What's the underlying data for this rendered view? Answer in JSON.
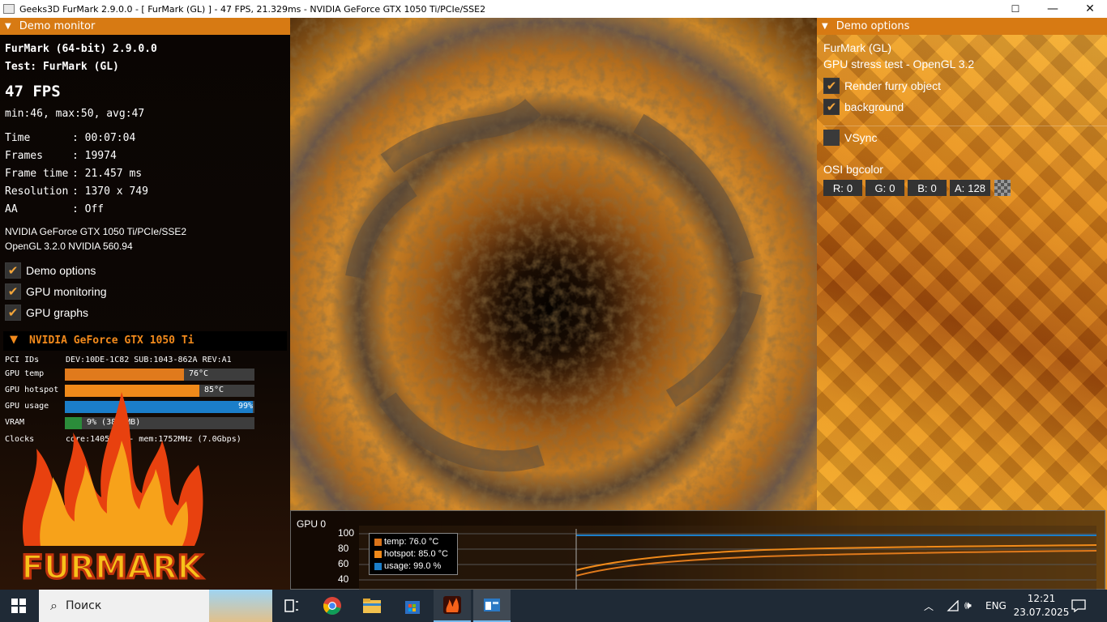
{
  "window": {
    "title": "Geeks3D FurMark 2.9.0.0 - [ FurMark (GL) ] - 47 FPS, 21.329ms - NVIDIA GeForce GTX 1050 Ti/PCIe/SSE2",
    "minimize_glyph": "—",
    "maximize_glyph": "☐",
    "close_glyph": "✕"
  },
  "monitor": {
    "header": "Demo monitor",
    "app_name": "FurMark (64-bit) 2.9.0.0",
    "test": "Test: FurMark (GL)",
    "fps": "47 FPS",
    "fps_stats": "min:46, max:50, avg:47",
    "stats": [
      {
        "label": "Time",
        "value": ": 00:07:04"
      },
      {
        "label": "Frames",
        "value": ": 19974"
      },
      {
        "label": "Frame time",
        "value": ": 21.457 ms"
      },
      {
        "label": "Resolution",
        "value": ": 1370 x 749"
      },
      {
        "label": "AA",
        "value": ": Off"
      }
    ],
    "renderer": "NVIDIA GeForce GTX 1050 Ti/PCIe/SSE2",
    "opengl": "OpenGL 3.2.0 NVIDIA 560.94",
    "toggles": [
      {
        "label": "Demo options",
        "checked": true
      },
      {
        "label": "GPU monitoring",
        "checked": true
      },
      {
        "label": "GPU graphs",
        "checked": true
      }
    ]
  },
  "gpu": {
    "name": "NVIDIA GeForce GTX 1050 Ti",
    "pci_label": "PCI IDs",
    "pci_value": "DEV:10DE-1C82 SUB:1043-862A REV:A1",
    "rows": [
      {
        "label": "GPU temp",
        "value": "76°C",
        "fill": 0.63,
        "color": "#e07a1c"
      },
      {
        "label": "GPU hotspot",
        "value": "85°C",
        "fill": 0.71,
        "color": "#f08a1a"
      },
      {
        "label": "GPU usage",
        "value": "99%",
        "fill": 0.99,
        "color": "#1b7ec9"
      },
      {
        "label": "VRAM",
        "value": "9% (381 MB)",
        "fill": 0.09,
        "color": "#2b8c3a"
      }
    ],
    "clocks_label": "Clocks",
    "clocks_value": "core:1405MHz - mem:1752MHz (7.0Gbps)",
    "logo_text": "FURMARK"
  },
  "options": {
    "header": "Demo options",
    "name": "FurMark (GL)",
    "description": "GPU stress test - OpenGL 3.2",
    "checks": [
      {
        "label": "Render furry object",
        "checked": true
      },
      {
        "label": "background",
        "checked": true
      },
      {
        "label": "VSync",
        "checked": false
      }
    ],
    "bgcolor_label": "OSI bgcolor",
    "bgcolor": [
      {
        "label": "R:",
        "value": "0"
      },
      {
        "label": "G:",
        "value": "0"
      },
      {
        "label": "B:",
        "value": "0"
      },
      {
        "label": "A:",
        "value": "128"
      }
    ]
  },
  "graph": {
    "title": "GPU 0",
    "y_ticks": [
      "100",
      "80",
      "60",
      "40"
    ],
    "legend": [
      {
        "label": "temp: 76.0 °C",
        "color": "#d9731a"
      },
      {
        "label": "hotspot: 85.0 °C",
        "color": "#f08a1a"
      },
      {
        "label": "usage: 99.0 %",
        "color": "#1b7ec9"
      }
    ]
  },
  "taskbar": {
    "search_placeholder": "Поиск",
    "language": "ENG",
    "time": "12:21",
    "date": "23.07.2025"
  }
}
